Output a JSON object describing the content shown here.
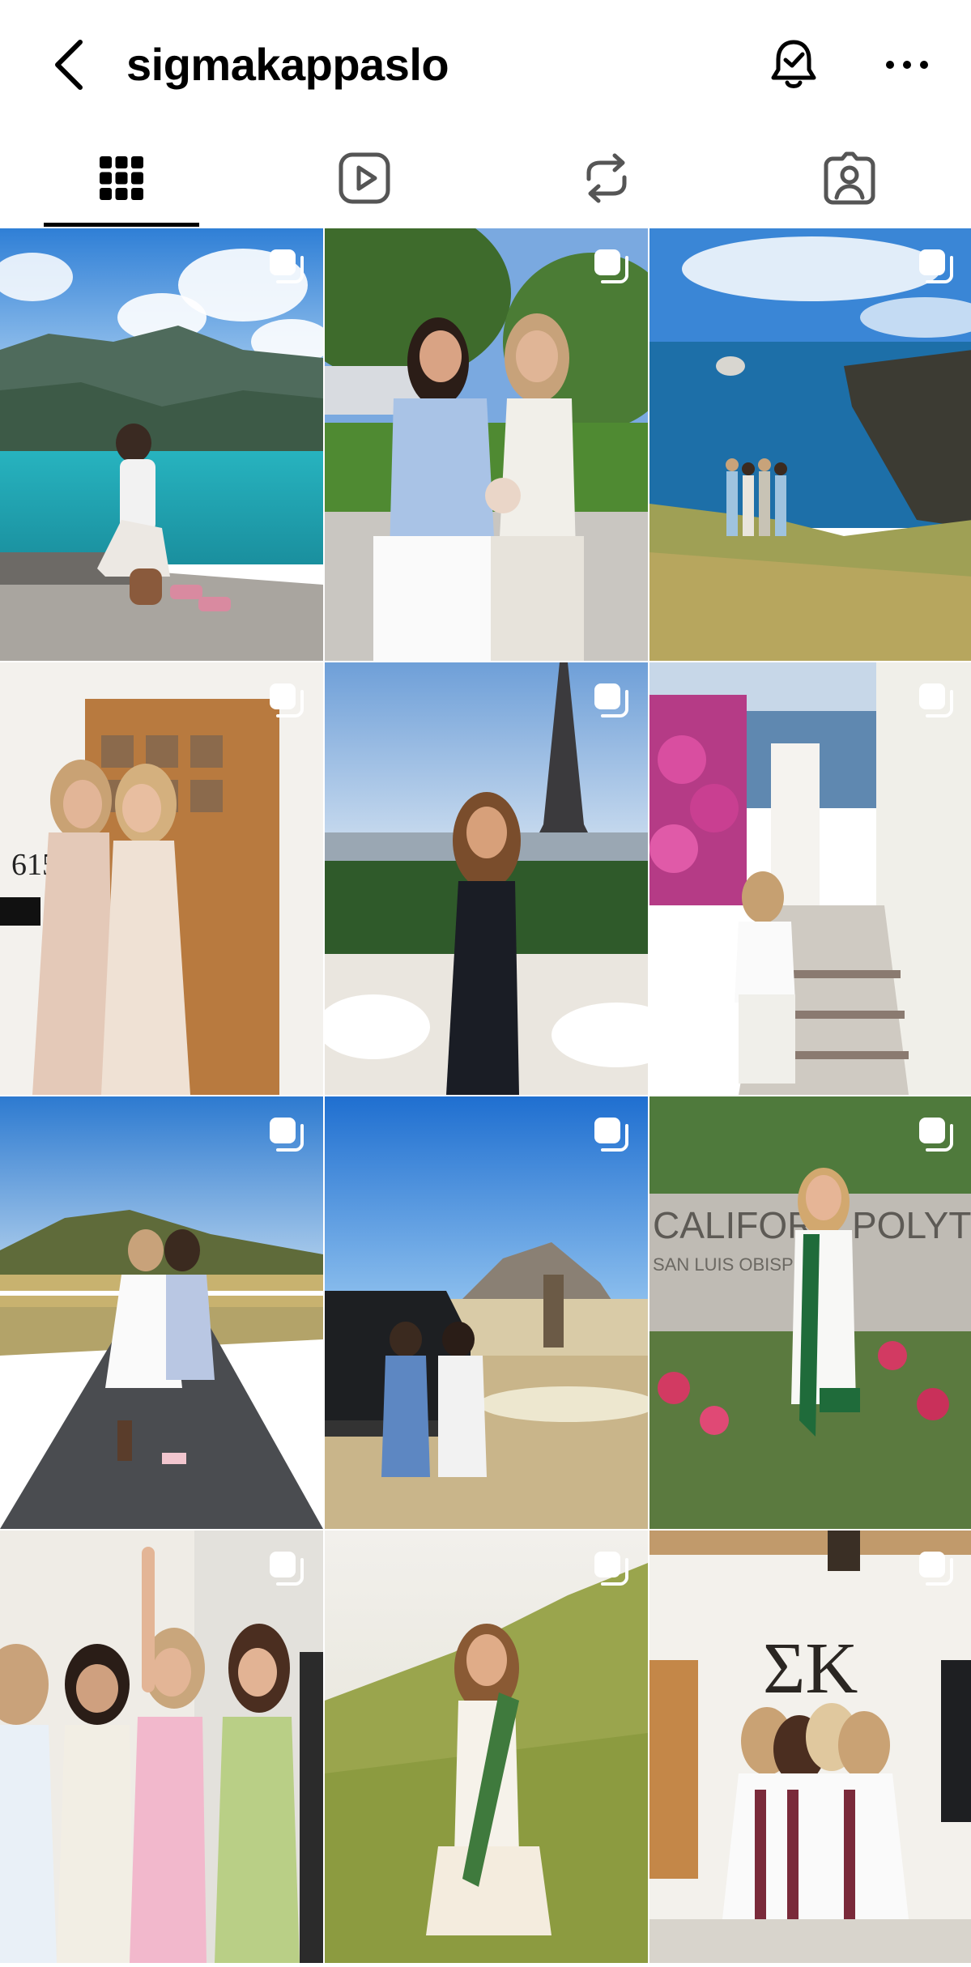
{
  "header": {
    "username": "sigmakappaslo",
    "back_icon": "chevron-left-icon",
    "bell_icon": "bell-check-icon",
    "more_icon": "ellipsis-icon"
  },
  "tabs": [
    {
      "name": "posts",
      "icon": "grid-icon",
      "active": true
    },
    {
      "name": "reels",
      "icon": "reels-play-icon",
      "active": false
    },
    {
      "name": "reposts",
      "icon": "repost-icon",
      "active": false
    },
    {
      "name": "tagged",
      "icon": "tagged-person-icon",
      "active": false
    }
  ],
  "posts": [
    {
      "scene": "lake-mountains",
      "multi": true
    },
    {
      "scene": "garden-two-women",
      "multi": true
    },
    {
      "scene": "coastal-cliff",
      "multi": true
    },
    {
      "scene": "door-615",
      "multi": true,
      "visible_text": "615"
    },
    {
      "scene": "eiffel-tower",
      "multi": true
    },
    {
      "scene": "santorini-stairs",
      "multi": true
    },
    {
      "scene": "country-road",
      "multi": true
    },
    {
      "scene": "morro-rock",
      "multi": true
    },
    {
      "scene": "cal-poly-sign",
      "multi": true,
      "visible_text": [
        "CALIFORN",
        "POLYTEC",
        "SAN LUIS OBISP"
      ]
    },
    {
      "scene": "group-selfie",
      "multi": true
    },
    {
      "scene": "hillside-graduate",
      "multi": true
    },
    {
      "scene": "sorority-house",
      "multi": true,
      "visible_text": "ΣΚ"
    }
  ],
  "colors": {
    "text": "#000000",
    "background": "#ffffff",
    "tab_indicator": "#000000",
    "icon_inactive": "#555555"
  }
}
